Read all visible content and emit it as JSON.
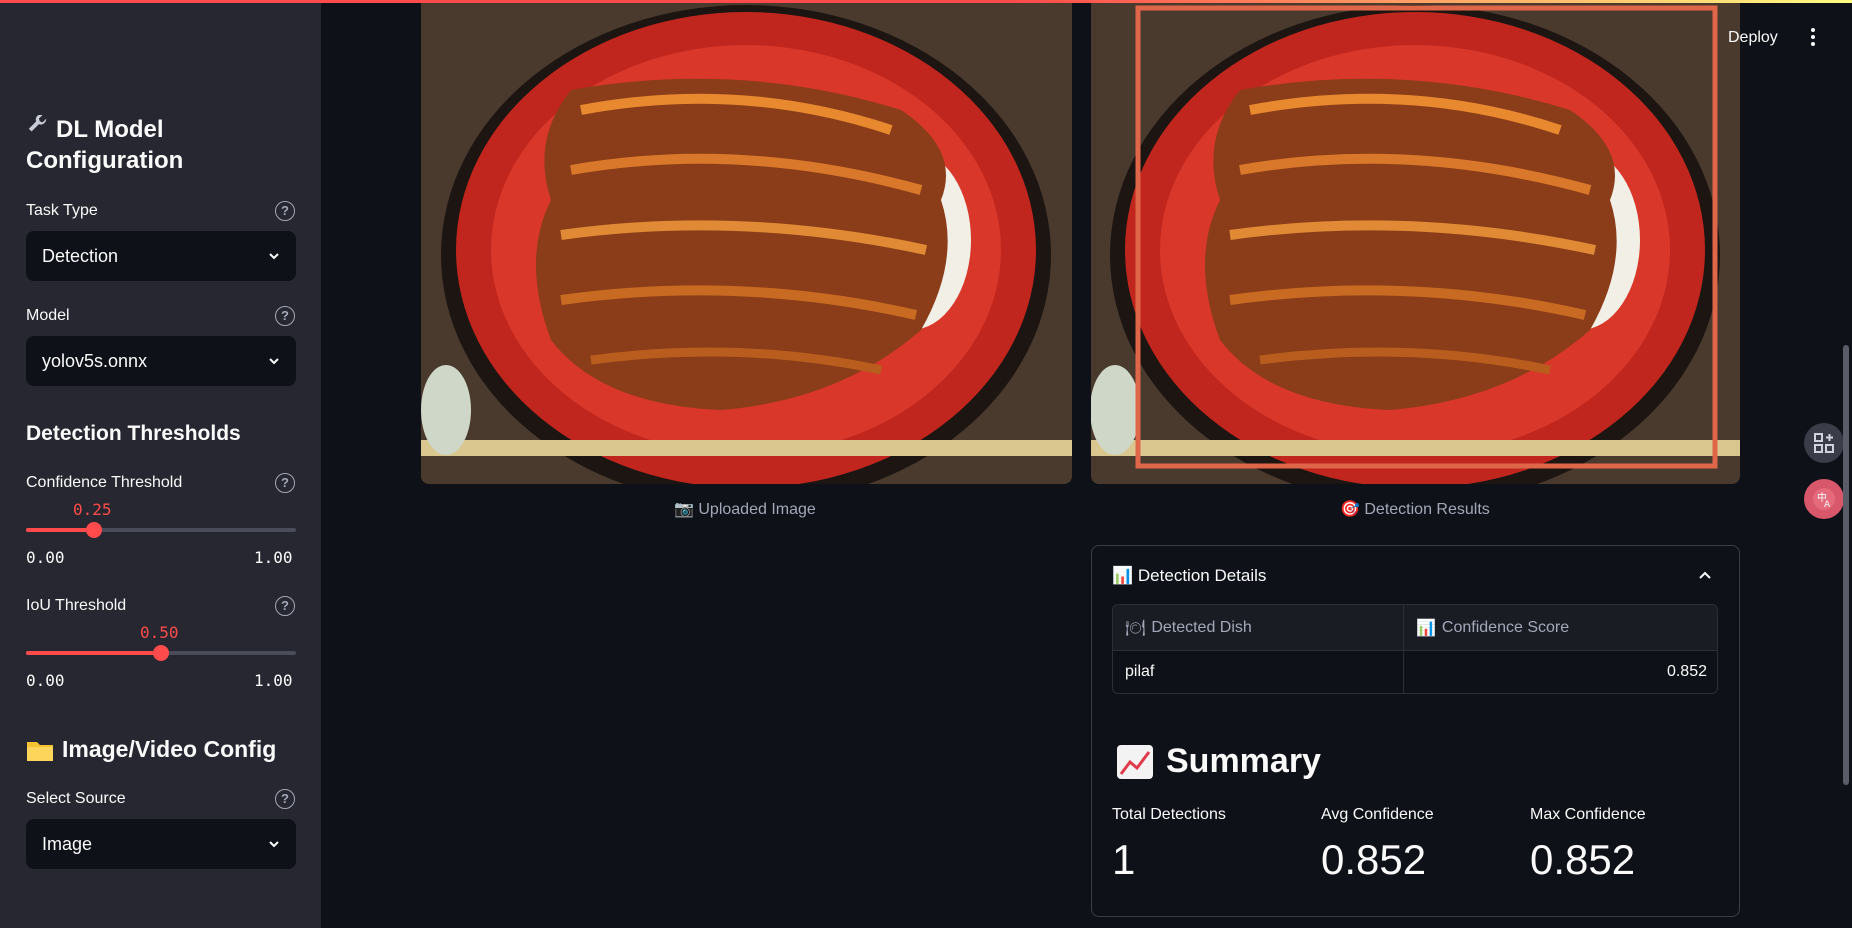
{
  "sidebar": {
    "title": "DL Model Configuration",
    "title_icon": "wrench-icon",
    "task_type": {
      "label": "Task Type",
      "value": "Detection"
    },
    "model": {
      "label": "Model",
      "value": "yolov5s.onnx"
    },
    "thresholds_heading": "Detection Thresholds",
    "confidence": {
      "label": "Confidence Threshold",
      "value": "0.25",
      "level": 0.25,
      "min": "0.00",
      "max": "1.00"
    },
    "iou": {
      "label": "IoU Threshold",
      "value": "0.50",
      "level": 0.5,
      "min": "0.00",
      "max": "1.00"
    },
    "source_heading": "Image/Video Config",
    "source_heading_icon": "folder-icon",
    "source": {
      "label": "Select Source",
      "value": "Image"
    }
  },
  "header": {
    "deploy_label": "Deploy"
  },
  "main": {
    "uploaded_caption": "Uploaded Image",
    "uploaded_icon": "camera-icon",
    "results_caption": "Detection Results",
    "results_icon": "target-icon",
    "details": {
      "title": "Detection Details",
      "icon": "bar-chart-icon",
      "columns": [
        "Detected Dish",
        "Confidence Score"
      ],
      "rows": [
        {
          "dish": "pilaf",
          "score": "0.852"
        }
      ]
    },
    "summary": {
      "title": "Summary",
      "icon": "trend-chart-icon",
      "metrics": [
        {
          "label": "Total Detections",
          "value": "1"
        },
        {
          "label": "Avg Confidence",
          "value": "0.852"
        },
        {
          "label": "Max Confidence",
          "value": "0.852"
        }
      ]
    }
  },
  "colors": {
    "accent": "#ff4b4b",
    "background": "#0e1117",
    "sidebar": "#262730",
    "box": "#e0664a"
  }
}
